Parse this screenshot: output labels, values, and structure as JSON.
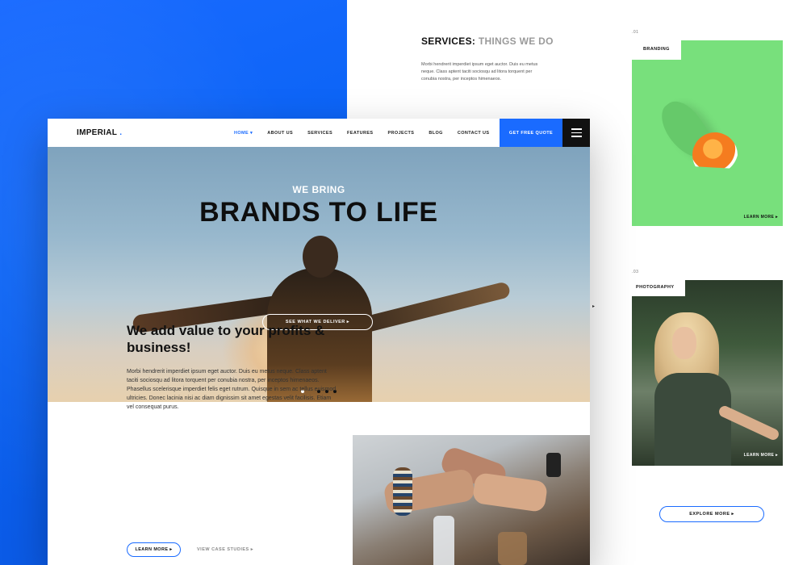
{
  "services": {
    "title_main": "SERVICES:",
    "title_sub": "THINGS WE DO",
    "text": "Morbi hendrerit imperdiet ipsum eget auctor. Duis eu metus neque. Class aptent taciti sociosqu ad litora torquent per conubia nostra, per inceptos himenaeos."
  },
  "cards": [
    {
      "num": ".01",
      "label": "BRANDING",
      "more": "LEARN MORE"
    },
    {
      "num": ".03",
      "label": "PHOTOGRAPHY",
      "more": "LEARN MORE"
    }
  ],
  "explore_label": "EXPLORE MORE",
  "nav": {
    "logo": "IMPERIAL",
    "logo_dot": ".",
    "items": [
      "HOME",
      "ABOUT US",
      "SERVICES",
      "FEATURES",
      "PROJECTS",
      "BLOG",
      "CONTACT US"
    ],
    "quote": "GET FREE QUOTE"
  },
  "hero": {
    "sub": "WE BRING",
    "title": "BRANDS TO LIFE",
    "cta": "SEE WHAT WE DELIVER"
  },
  "value": {
    "heading": "We add value to your profits & business!",
    "body": "Morbi hendrerit imperdiet ipsum eget auctor. Duis eu metus neque. Class aptent taciti sociosqu ad litora torquent per conubia nostra, per inceptos himenaeos. Phasellus scelerisque imperdiet felis eget rutrum. Quisque in sem ac tellus euismod ultricies. Donec lacinia nisi ac diam dignissim sit amet egestas velit facilisis. Etiam vel consequat purus.",
    "learn": "LEARN MORE",
    "case": "VIEW CASE STUDIES"
  },
  "colors": {
    "accent": "#1a6bff",
    "dark": "#111111"
  }
}
